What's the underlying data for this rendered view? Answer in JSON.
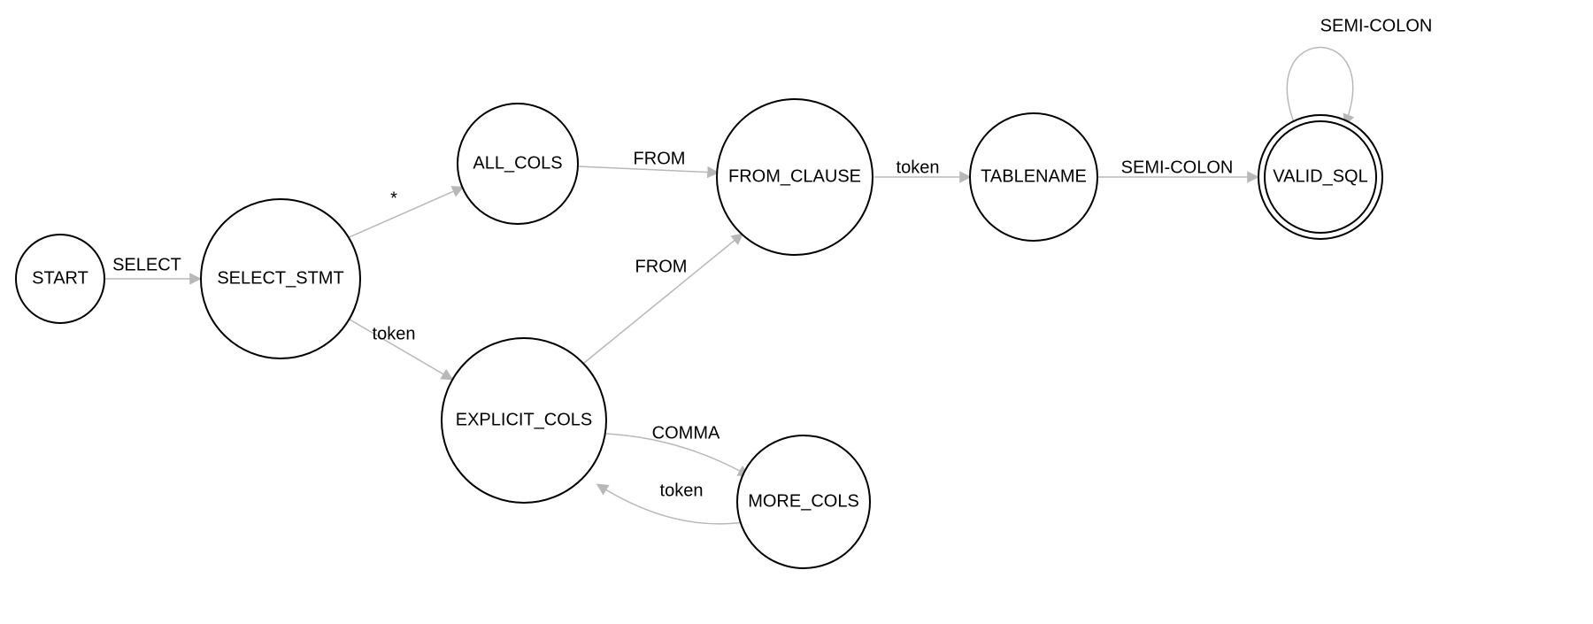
{
  "diagram": {
    "type": "state-machine",
    "nodes": {
      "start": {
        "label": "START",
        "r": 50,
        "accept": false
      },
      "select_stmt": {
        "label": "SELECT_STMT",
        "r": 90,
        "accept": false
      },
      "all_cols": {
        "label": "ALL_COLS",
        "r": 68,
        "accept": false
      },
      "explicit_cols": {
        "label": "EXPLICIT_COLS",
        "r": 93,
        "accept": false
      },
      "from_clause": {
        "label": "FROM_CLAUSE",
        "r": 88,
        "accept": false
      },
      "more_cols": {
        "label": "MORE_COLS",
        "r": 75,
        "accept": false
      },
      "tablename": {
        "label": "TABLENAME",
        "r": 72,
        "accept": false
      },
      "valid_sql": {
        "label": "VALID_SQL",
        "r": 70,
        "accept": true
      }
    },
    "edges": {
      "start_select_stmt": {
        "label": "SELECT",
        "from": "start",
        "to": "select_stmt"
      },
      "select_stmt_all_cols": {
        "label": "*",
        "from": "select_stmt",
        "to": "all_cols"
      },
      "select_stmt_explicit_cols": {
        "label": "token",
        "from": "select_stmt",
        "to": "explicit_cols"
      },
      "all_cols_from_clause": {
        "label": "FROM",
        "from": "all_cols",
        "to": "from_clause"
      },
      "explicit_cols_from_clause": {
        "label": "FROM",
        "from": "explicit_cols",
        "to": "from_clause"
      },
      "explicit_cols_more_cols": {
        "label": "COMMA",
        "from": "explicit_cols",
        "to": "more_cols"
      },
      "more_cols_explicit_cols": {
        "label": "token",
        "from": "more_cols",
        "to": "explicit_cols"
      },
      "from_clause_tablename": {
        "label": "token",
        "from": "from_clause",
        "to": "tablename"
      },
      "tablename_valid_sql": {
        "label": "SEMI-COLON",
        "from": "tablename",
        "to": "valid_sql"
      },
      "valid_sql_valid_sql": {
        "label": "SEMI-COLON",
        "from": "valid_sql",
        "to": "valid_sql"
      }
    }
  }
}
